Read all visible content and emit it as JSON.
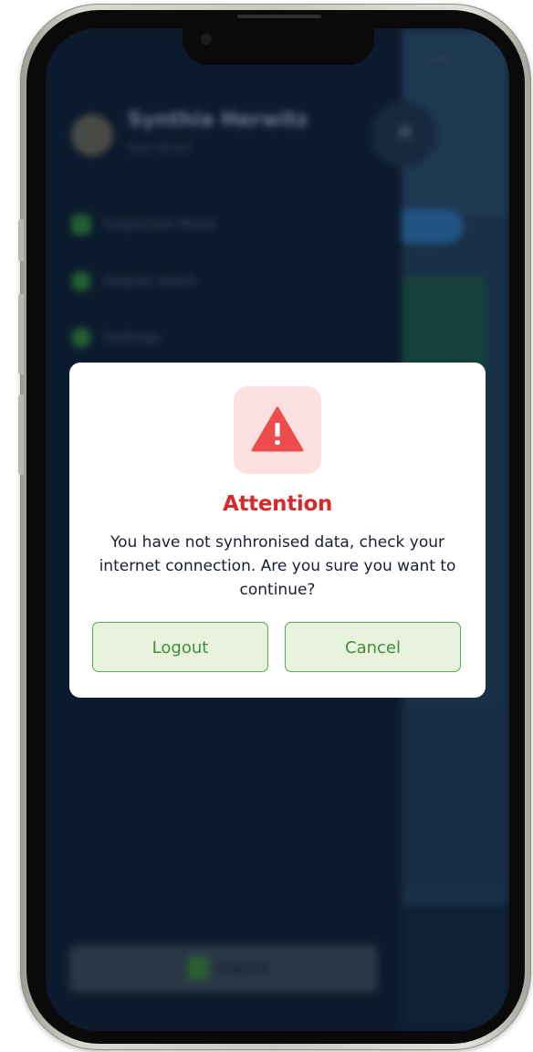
{
  "background": {
    "user_name": "Synthia Herwitz",
    "user_role": "Solo driver",
    "menu": [
      {
        "label": "Inspection Mode"
      },
      {
        "label": "Inspect Asset"
      },
      {
        "label": "Settings"
      }
    ],
    "logout_label": "Logout"
  },
  "dialog": {
    "icon": "warning-triangle-icon",
    "title": "Attention",
    "message": "You have not synhronised data, check your internet connection. Are you sure you want to continue?",
    "logout_button": "Logout",
    "cancel_button": "Cancel"
  },
  "colors": {
    "accent_red": "#d92a2a",
    "accent_green": "#4caf50",
    "drawer_bg": "#0f1f35"
  }
}
